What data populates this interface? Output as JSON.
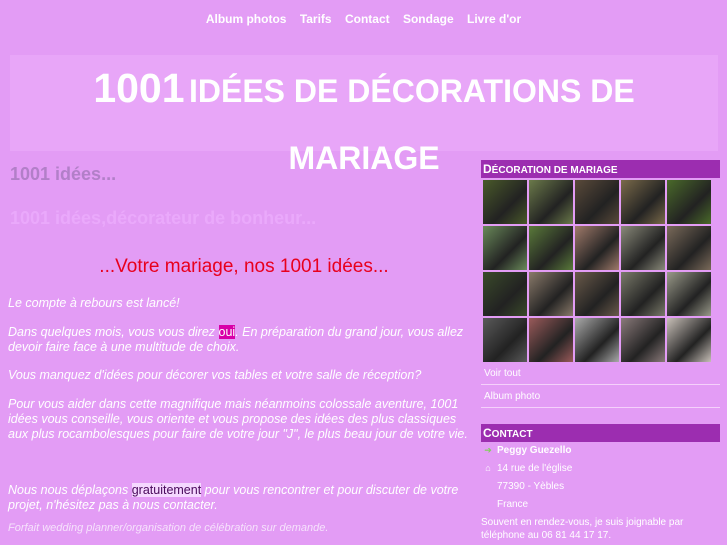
{
  "nav": [
    "Album photos",
    "Tarifs",
    "Contact",
    "Sondage",
    "Livre d'or"
  ],
  "title": {
    "number": "1001",
    "line1_rest": "IDÉES DE DÉCORATIONS DE",
    "line2": "MARIAGE"
  },
  "heading_ideas": "1001 idées...",
  "heading_deco": "1001 idées,décorateur de bonheur...",
  "slogan": "...Votre mariage, nos 1001 idées...",
  "paragraphs": {
    "p1": "Le compte à rebours est lancé!",
    "p2_before": "Dans quelques mois, vous vous direz ",
    "p2_highlight": "oui",
    "p2_after": ". En préparation du grand jour, vous allez devoir faire face à une multitude de choix.",
    "p3": "Vous manquez d'idées pour décorer vos tables et votre salle de réception?",
    "p4": "Pour vous aider dans cette magnifique mais néanmoins colossale aventure, 1001 idées vous conseille, vous oriente et vous propose des idées des plus classiques aux plus rocambolesques pour faire de votre jour \"J\", le plus beau jour de votre vie.",
    "p5_before": "Nous nous déplaçons ",
    "p5_highlight": "gratuitement",
    "p5_after": " pour vous rencontrer et pour discuter de votre projet, n'hésitez pas à nous contacter."
  },
  "forfait": "Forfait wedding planner/organisation de célébration sur demande.",
  "sidebar": {
    "gallery_header_cap": "D",
    "gallery_header_rest": "écoration de mariage",
    "photo_colors": [
      "#4a5a2a",
      "#6b7a4a",
      "#5a4a3a",
      "#7a6a4a",
      "#4a6a2a",
      "#6a8a5a",
      "#5a7a3a",
      "#a07a6a",
      "#8a8a7a",
      "#7a6a5a",
      "#3a4a2a",
      "#8a7a6a",
      "#6a5a4a",
      "#7a7a6a",
      "#9a9a8a",
      "#5a5a5a",
      "#9a5a5a",
      "#aaaaaa",
      "#8a7a7a",
      "#c8c0b8"
    ],
    "link_all": "Voir tout",
    "link_album": "Album photo",
    "contact_header_cap": "C",
    "contact_header_rest": "ontact",
    "name": "Peggy Guezello",
    "street": "14 rue de l'église",
    "city": "77390 - Yèbles",
    "country": "France",
    "note": "Souvent en rendez-vous, je suis joignable par téléphone au 06 81 44 17 17."
  }
}
